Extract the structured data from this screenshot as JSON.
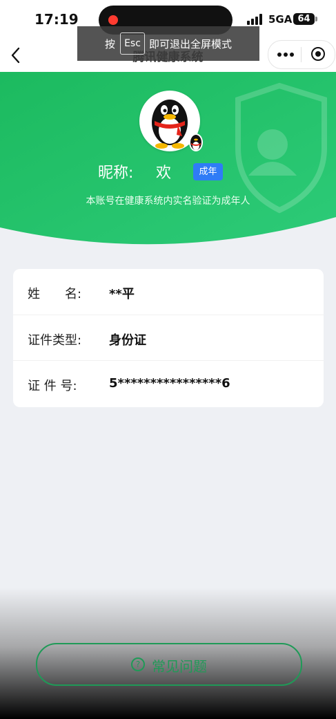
{
  "status_bar": {
    "time": "17:19",
    "network": "5GA",
    "battery": "64"
  },
  "nav": {
    "title": "腾讯健康系统"
  },
  "esc_toast": {
    "prefix": "按",
    "key": "Esc",
    "suffix": "即可退出全屏模式"
  },
  "profile": {
    "nickname_label": "昵称:",
    "nickname_value": "欢",
    "age_tag": "成年",
    "verify_text": "本账号在健康系统内实名验证为成年人"
  },
  "info": {
    "rows": [
      {
        "label": "姓　　名:",
        "value": "**平"
      },
      {
        "label": "证件类型:",
        "value": "身份证"
      },
      {
        "label": "证 件 号:",
        "value": "5****************6"
      }
    ]
  },
  "faq": {
    "label": "常见问题"
  },
  "colors": {
    "brand_green": "#1f9a57",
    "header_green": "#21c26a",
    "tag_blue": "#2f7cf6"
  }
}
